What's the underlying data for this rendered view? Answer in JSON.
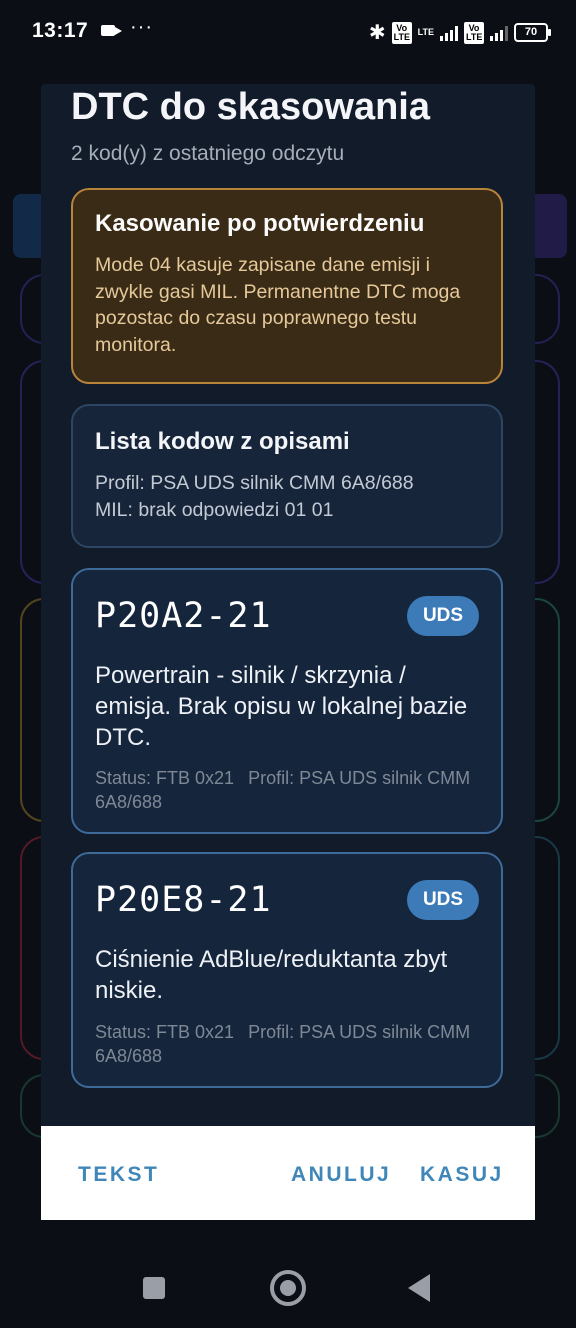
{
  "status_bar": {
    "time": "13:17",
    "more": "···",
    "volte": "Vo LTE",
    "lte": "LTE",
    "battery": "70"
  },
  "dialog": {
    "title": "DTC do skasowania",
    "subtitle": "2 kod(y) z ostatniego odczytu",
    "warning": {
      "title": "Kasowanie po potwierdzeniu",
      "text": "Mode 04 kasuje zapisane dane emisji i zwykle gasi MIL. Permanentne DTC moga pozostac do czasu poprawnego testu monitora."
    },
    "info": {
      "title": "Lista kodow z opisami",
      "profile": "Profil: PSA UDS silnik CMM 6A8/688",
      "mil": "MIL: brak odpowiedzi 01 01"
    },
    "dtcs": [
      {
        "code": "P20A2-21",
        "badge": "UDS",
        "description": "Powertrain - silnik / skrzynia / emisja. Brak opisu w lokalnej bazie DTC.",
        "status": "Status: FTB 0x21",
        "profile": "Profil: PSA UDS silnik CMM 6A8/688"
      },
      {
        "code": "P20E8-21",
        "badge": "UDS",
        "description": "Ciśnienie AdBlue/reduktanta zbyt niskie.",
        "status": "Status: FTB 0x21",
        "profile": "Profil: PSA UDS silnik CMM 6A8/688"
      }
    ],
    "actions": {
      "text": "TEKST",
      "cancel": "ANULUJ",
      "delete": "KASUJ"
    }
  },
  "colors": {
    "accent": "#3f87b8",
    "badge": "#3c7ab8",
    "warning_border": "#b8843a",
    "dialog_bg": "#121b29"
  },
  "nav": {
    "recent_icon": "square-recent-apps-icon",
    "home_icon": "circle-home-icon",
    "back_icon": "triangle-back-icon"
  }
}
